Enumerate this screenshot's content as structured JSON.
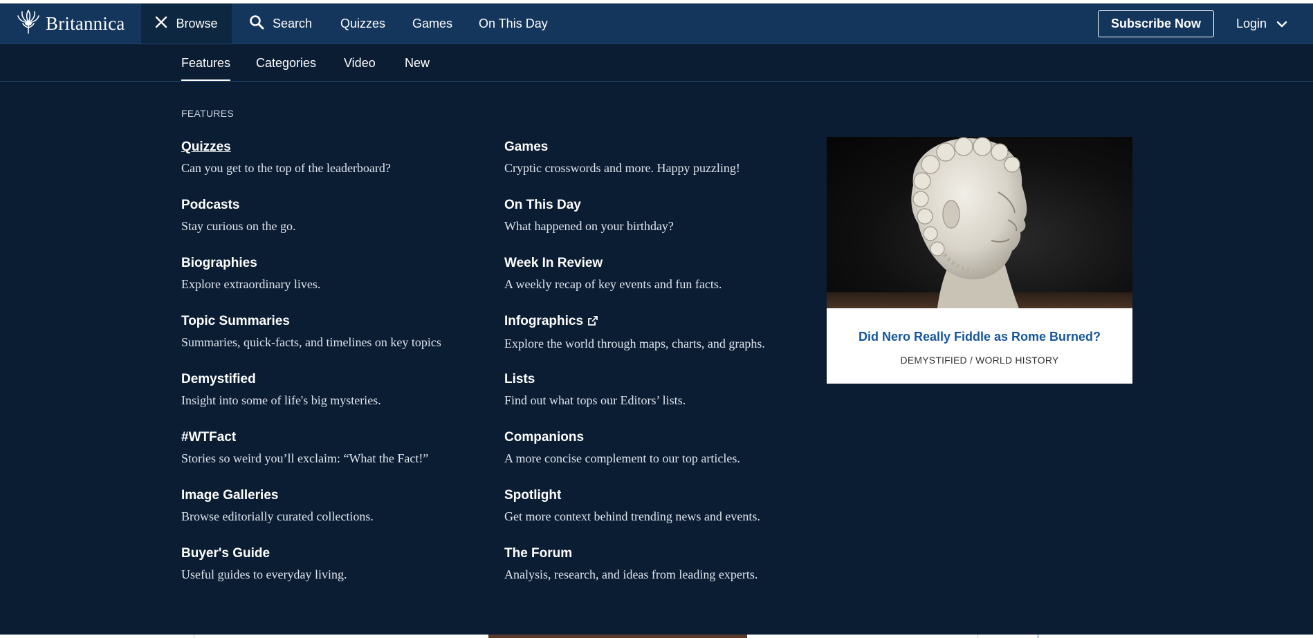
{
  "header": {
    "logo_text": "Britannica",
    "browse_label": "Browse",
    "search_label": "Search",
    "nav_links": [
      "Quizzes",
      "Games",
      "On This Day"
    ],
    "subscribe_label": "Subscribe Now",
    "login_label": "Login"
  },
  "subnav": {
    "tabs": [
      "Features",
      "Categories",
      "Video",
      "New"
    ],
    "active": "Features"
  },
  "features": {
    "section_label": "FEATURES",
    "left": [
      {
        "title": "Quizzes",
        "desc": "Can you get to the top of the leaderboard?"
      },
      {
        "title": "Podcasts",
        "desc": "Stay curious on the go."
      },
      {
        "title": "Biographies",
        "desc": "Explore extraordinary lives."
      },
      {
        "title": "Topic Summaries",
        "desc": "Summaries, quick-facts, and timelines on key topics"
      },
      {
        "title": "Demystified",
        "desc": "Insight into some of life's big mysteries."
      },
      {
        "title": "#WTFact",
        "desc": "Stories so weird you’ll exclaim: “What the Fact!”"
      },
      {
        "title": "Image Galleries",
        "desc": "Browse editorially curated collections."
      },
      {
        "title": "Buyer's Guide",
        "desc": "Useful guides to everyday living."
      }
    ],
    "right": [
      {
        "title": "Games",
        "desc": "Cryptic crosswords and more. Happy puzzling!"
      },
      {
        "title": "On This Day",
        "desc": "What happened on your birthday?"
      },
      {
        "title": "Week In Review",
        "desc": "A weekly recap of key events and fun facts."
      },
      {
        "title": "Infographics",
        "desc": "Explore the world through maps, charts, and graphs."
      },
      {
        "title": "Lists",
        "desc": "Find out what tops our Editors’ lists."
      },
      {
        "title": "Companions",
        "desc": "A more concise complement to our top articles."
      },
      {
        "title": "Spotlight",
        "desc": "Get more context behind trending news and events."
      },
      {
        "title": "The Forum",
        "desc": "Analysis, research, and ideas from leading experts."
      }
    ]
  },
  "promo": {
    "title": "Did Nero Really Fiddle as Rome Burned?",
    "meta": "DEMYSTIFIED / WORLD HISTORY"
  },
  "icons": {
    "logo": "thistle-logo-icon",
    "browse": "close-icon",
    "search": "search-icon",
    "login": "chevron-down-icon",
    "infographics": "external-link-icon"
  },
  "colors": {
    "nav_bg": "#14365c",
    "panel_bg": "#0b1d33",
    "link_blue": "#14569c"
  }
}
